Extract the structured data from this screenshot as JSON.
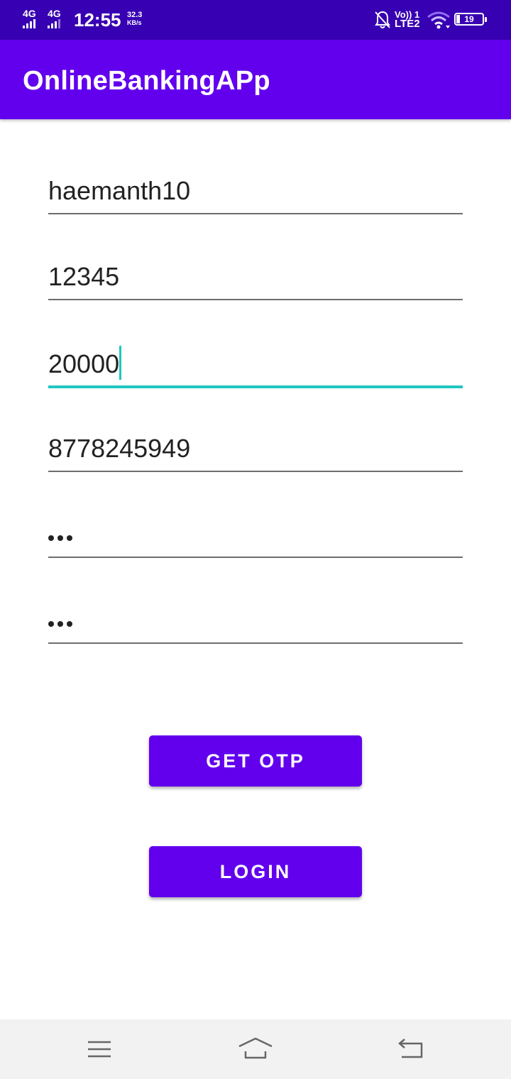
{
  "status_bar": {
    "sim1_label": "4G",
    "sim2_label": "4G",
    "time": "12:55",
    "net_speed_value": "32.3",
    "net_speed_unit": "KB/s",
    "volte_label": "Vo)) 1",
    "lte_label": "LTE2",
    "battery_level": "19",
    "icons": [
      "signal-icon",
      "notifications-off-icon",
      "wifi-icon",
      "battery-icon"
    ]
  },
  "app_bar": {
    "title": "OnlineBankingAPp"
  },
  "form": {
    "username_value": "haemanth10",
    "account_value": "12345",
    "amount_value": "20000",
    "phone_value": "8778245949",
    "password_masked": "•••",
    "confirm_masked": "•••"
  },
  "buttons": {
    "get_otp_label": "GET OTP",
    "login_label": "LOGIN"
  },
  "nav_bar": {
    "icons": [
      "menu-icon",
      "home-icon",
      "back-icon"
    ]
  },
  "colors": {
    "status_bar": "#3700b3",
    "primary": "#6200ee",
    "accent": "#1ec7c0"
  }
}
